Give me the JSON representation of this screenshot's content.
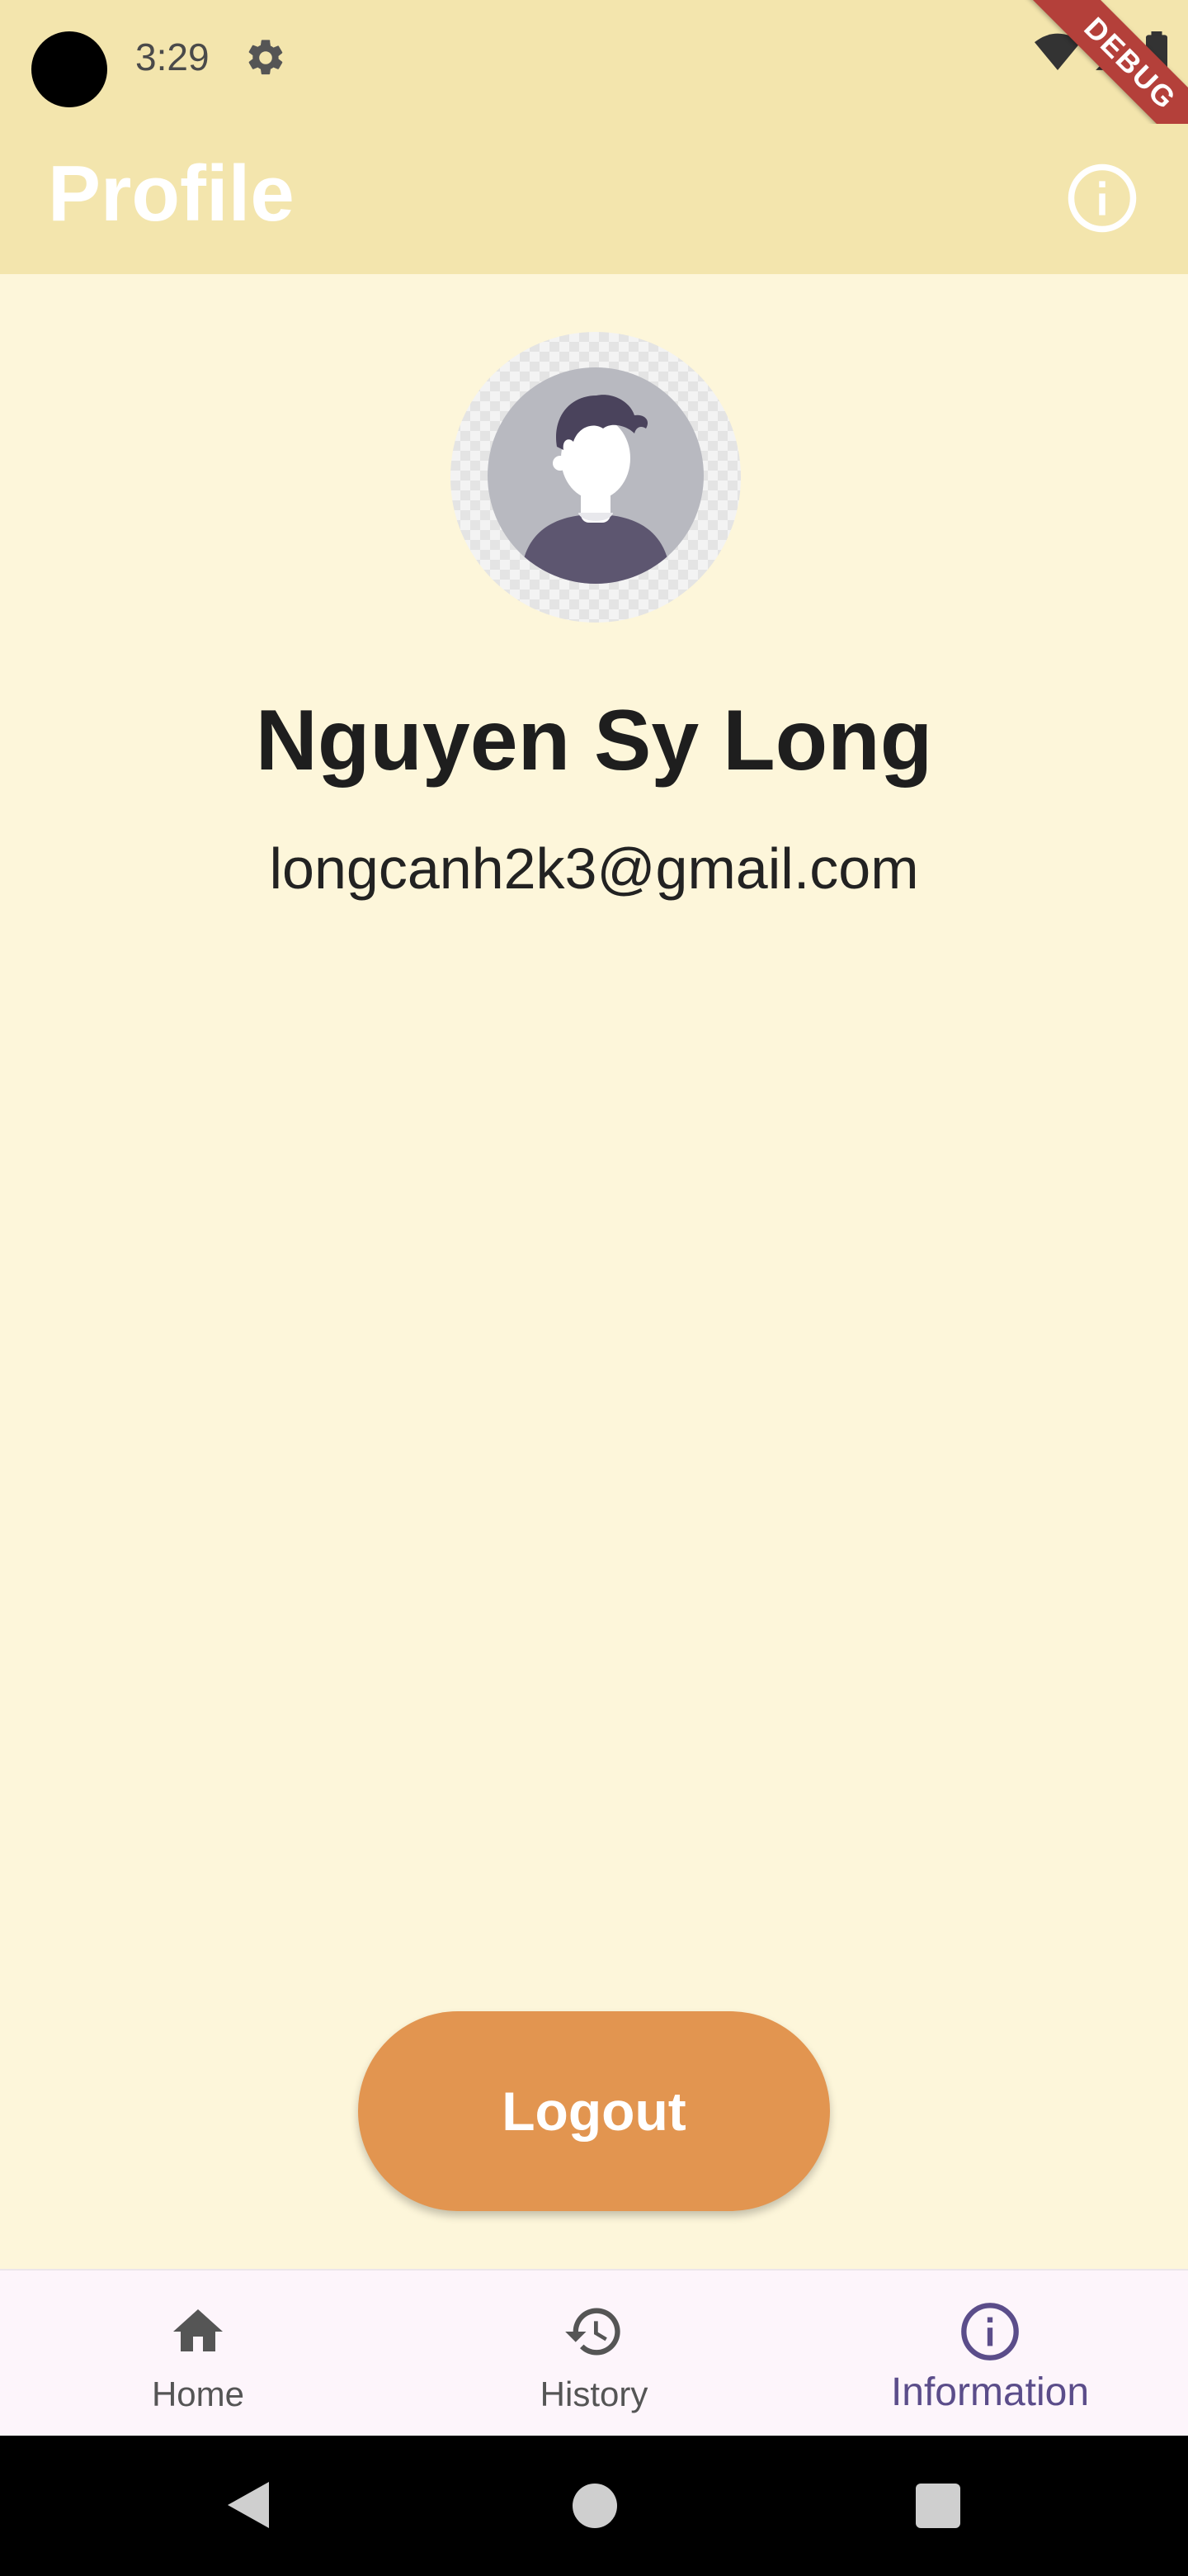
{
  "status_bar": {
    "time": "3:29",
    "icons": [
      "camera-cutout",
      "gear-icon",
      "wifi-icon",
      "signal-icon",
      "battery-icon"
    ]
  },
  "debug_banner": "DEBUG",
  "app_bar": {
    "title": "Profile",
    "action_icon": "info-icon"
  },
  "profile": {
    "avatar_icon": "person-avatar",
    "name": "Nguyen Sy Long",
    "email": "longcanh2k3@gmail.com"
  },
  "logout_label": "Logout",
  "bottom_nav": {
    "items": [
      {
        "label": "Home",
        "icon": "home-icon",
        "active": false
      },
      {
        "label": "History",
        "icon": "history-icon",
        "active": false
      },
      {
        "label": "Information",
        "icon": "info-icon",
        "active": true
      }
    ]
  },
  "colors": {
    "app_bar": "#f3e5ad",
    "background": "#fdf6da",
    "logout_button": "#e29550",
    "active_nav": "#5b4d8a",
    "debug_ribbon": "#b4403a"
  }
}
